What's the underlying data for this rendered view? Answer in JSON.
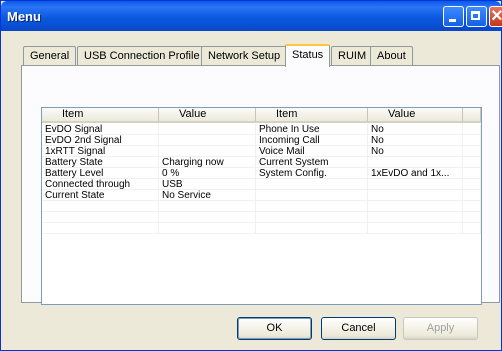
{
  "window": {
    "title": "Menu"
  },
  "tabs": [
    "General",
    "USB Connection Profile",
    "Network Setup",
    "Status",
    "RUIM",
    "About"
  ],
  "active_tab": "Status",
  "table": {
    "headers": [
      "Item",
      "Value",
      "Item",
      "Value"
    ],
    "rows": [
      [
        "EvDO Signal",
        "",
        "Phone In Use",
        "No"
      ],
      [
        "EvDO 2nd Signal",
        "",
        "Incoming Call",
        "No"
      ],
      [
        "1xRTT Signal",
        "",
        "Voice Mail",
        "No"
      ],
      [
        "Battery State",
        "Charging now",
        "Current System",
        ""
      ],
      [
        "Battery Level",
        "0 %",
        "System Config.",
        "1xEvDO and 1x..."
      ],
      [
        "Connected through",
        "USB",
        "",
        ""
      ],
      [
        "Current State",
        "No Service",
        "",
        ""
      ],
      [
        "",
        "",
        "",
        ""
      ],
      [
        "",
        "",
        "",
        ""
      ],
      [
        "",
        "",
        "",
        ""
      ]
    ]
  },
  "buttons": {
    "ok": "OK",
    "cancel": "Cancel",
    "apply": "Apply"
  }
}
